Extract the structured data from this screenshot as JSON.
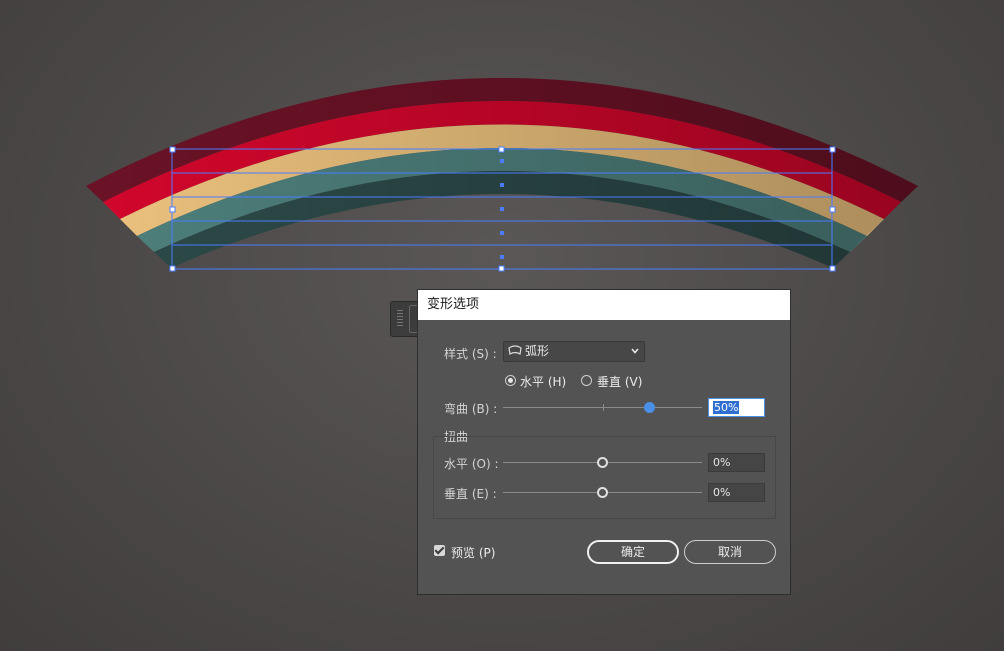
{
  "dialog": {
    "title": "变形选项",
    "style": {
      "label": "样式 (S) :",
      "value": "弧形",
      "icon": "arc-style-icon"
    },
    "orientation": {
      "horizontal_label": "水平 (H)",
      "vertical_label": "垂直 (V)",
      "selected": "horizontal"
    },
    "bend": {
      "label": "弯曲 (B) :",
      "value": "50%",
      "level": 50
    },
    "distortion": {
      "group_label": "扭曲",
      "horizontal": {
        "label": "水平 (O) :",
        "value": "0%",
        "level": 0
      },
      "vertical": {
        "label": "垂直 (E) :",
        "value": "0%",
        "level": 0
      }
    },
    "preview": {
      "label": "预览 (P)",
      "checked": true
    },
    "ok_label": "确定",
    "cancel_label": "取消"
  },
  "artwork": {
    "band_colors": [
      "#6b1226",
      "#d2062c",
      "#ecc27e",
      "#4e807c",
      "#2c4a49"
    ],
    "selection_color": "#4a7cff"
  }
}
